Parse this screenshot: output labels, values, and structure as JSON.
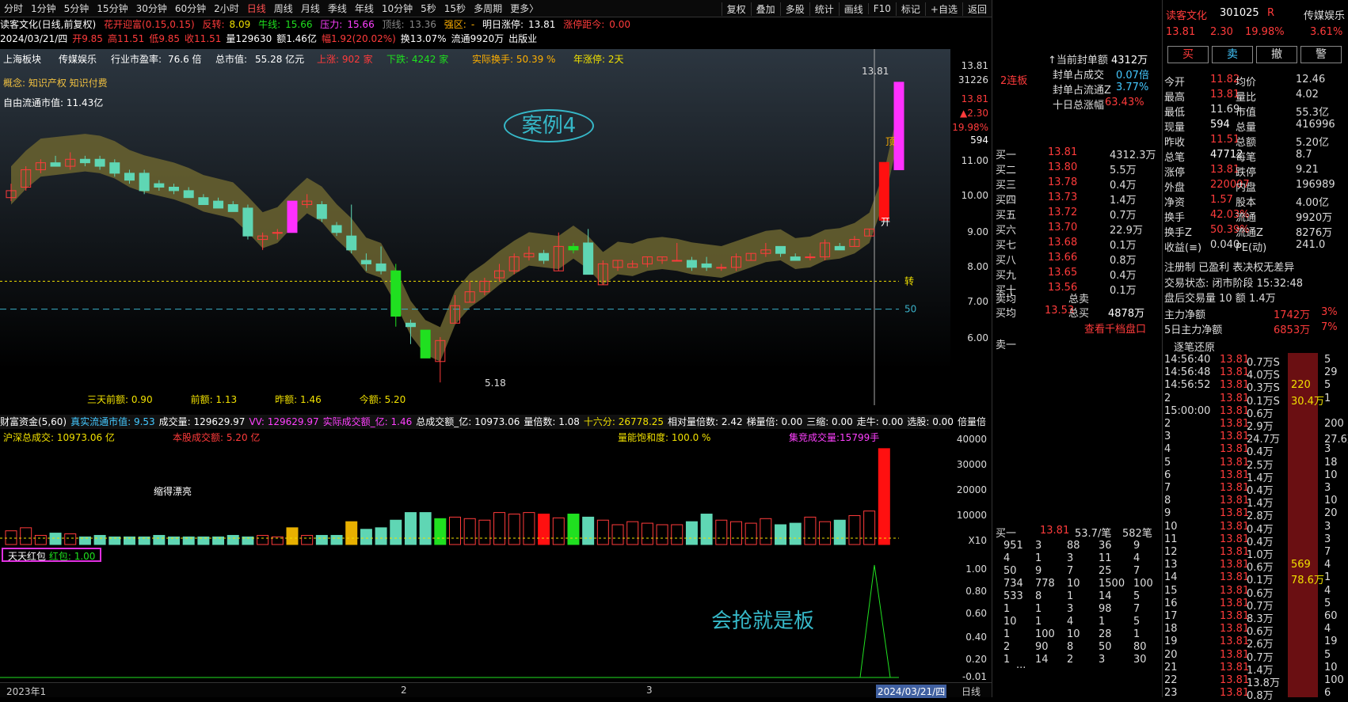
{
  "toolbar": {
    "periods": [
      "分时",
      "1分钟",
      "5分钟",
      "15分钟",
      "30分钟",
      "60分钟",
      "2小时",
      "日线",
      "周线",
      "月线",
      "季线",
      "年线",
      "10分钟",
      "5秒",
      "15秒",
      "多周期",
      "更多〉"
    ],
    "active": "日线",
    "right": [
      "复权",
      "叠加",
      "多股",
      "统计",
      "画线",
      "F10",
      "标记",
      "+自选",
      "返回"
    ]
  },
  "header": {
    "title": "读客文化(日线,前复权)",
    "indicator": "花开迎富(0.15,0.15)",
    "fanzhuan_label": "反转:",
    "fanzhuan": "8.09",
    "niuxian_label": "牛线:",
    "niuxian": "15.66",
    "yali_label": "压力:",
    "yali": "15.66",
    "dingxian_label": "顶线:",
    "dingxian": "13.36",
    "qiangqu_label": "强区:",
    "qiangqu": "-",
    "mingri_label": "明日涨停:",
    "mingri": "13.81",
    "zhangting_label": "涨停距今:",
    "zhangting": "0.00"
  },
  "ohlc": {
    "date": "2024/03/21/四",
    "open": "开9.85",
    "high": "高11.51",
    "low": "低9.85",
    "close": "收11.51",
    "vol": "量129630",
    "amt": "额1.46亿",
    "chg": "幅1.92(20.02%)",
    "turn": "换13.07%",
    "float": "流通9920万",
    "industry": "出版业"
  },
  "topinfo": {
    "board": "上海板块",
    "sector": "传媒娱乐",
    "pe_label": "行业市盈率:",
    "pe": "76.6 倍",
    "mv_label": "总市值:",
    "mv": "55.28 亿元",
    "up": "上涨: 902 家",
    "down": "下跌: 4242 家",
    "turnover": "实际换手: 50.39 %",
    "years": "年涨停: 2天"
  },
  "concept": "概念: 知识产权 知识付费",
  "ltmv": "自由流通市值: 11.43亿",
  "case_label": "案例4",
  "chart_data": {
    "type": "candlestick",
    "ylim": [
      5,
      14.5
    ],
    "candles": [
      [
        10.5,
        10.9,
        10.4,
        10.7
      ],
      [
        10.8,
        11.4,
        10.7,
        11.3
      ],
      [
        11.3,
        11.6,
        11.2,
        11.5
      ],
      [
        11.5,
        11.7,
        11.4,
        11.4
      ],
      [
        11.4,
        11.8,
        11.3,
        11.6
      ],
      [
        11.6,
        11.7,
        11.4,
        11.5
      ],
      [
        11.6,
        11.7,
        11.3,
        11.4
      ],
      [
        11.5,
        11.6,
        11.1,
        11.2
      ],
      [
        11.2,
        11.3,
        10.9,
        11.0
      ],
      [
        11.2,
        11.3,
        10.6,
        10.7
      ],
      [
        10.9,
        11.0,
        10.7,
        10.8
      ],
      [
        10.8,
        10.9,
        10.6,
        10.7
      ],
      [
        10.7,
        10.8,
        10.5,
        10.5
      ],
      [
        10.5,
        10.6,
        10.3,
        10.3
      ],
      [
        10.4,
        10.5,
        10.2,
        10.2
      ],
      [
        10.3,
        10.4,
        10.1,
        10.1
      ],
      [
        10.2,
        10.3,
        9.3,
        9.4
      ],
      [
        9.3,
        9.5,
        9.0,
        9.4
      ],
      [
        9.5,
        9.6,
        9.3,
        9.5
      ],
      [
        10.4,
        10.4,
        9.5,
        9.5
      ],
      [
        10.3,
        10.6,
        10.2,
        10.4
      ],
      [
        10.3,
        10.4,
        9.8,
        9.9
      ],
      [
        9.7,
        9.8,
        9.4,
        9.5
      ],
      [
        9.4,
        10.3,
        8.9,
        9.0
      ],
      [
        8.7,
        8.9,
        8.4,
        8.6
      ],
      [
        8.6,
        9.1,
        8.3,
        8.4
      ],
      [
        8.4,
        8.6,
        6.8,
        7.1
      ],
      [
        6.9,
        7.0,
        6.3,
        6.8
      ],
      [
        6.7,
        6.7,
        5.9,
        5.9
      ],
      [
        5.8,
        6.5,
        5.2,
        6.4
      ],
      [
        6.9,
        7.7,
        6.9,
        7.4
      ],
      [
        7.5,
        8.1,
        7.5,
        7.8
      ],
      [
        7.8,
        8.2,
        7.7,
        8.1
      ],
      [
        8.2,
        8.6,
        8.1,
        8.4
      ],
      [
        8.4,
        8.9,
        8.3,
        8.8
      ],
      [
        8.8,
        9.1,
        8.7,
        8.9
      ],
      [
        8.9,
        9.0,
        8.6,
        8.7
      ],
      [
        8.4,
        9.5,
        8.4,
        9.1
      ],
      [
        9.1,
        9.2,
        8.9,
        9.0
      ],
      [
        9.2,
        9.6,
        8.3,
        8.3
      ],
      [
        8.0,
        8.7,
        8.0,
        8.6
      ],
      [
        8.5,
        8.7,
        8.4,
        8.7
      ],
      [
        8.5,
        8.7,
        8.5,
        8.6
      ],
      [
        8.6,
        8.8,
        8.5,
        8.8
      ],
      [
        8.7,
        8.8,
        8.6,
        8.8
      ],
      [
        8.7,
        9.2,
        8.7,
        8.7
      ],
      [
        8.7,
        8.8,
        8.4,
        8.5
      ],
      [
        8.6,
        8.8,
        8.4,
        8.5
      ],
      [
        8.5,
        8.6,
        8.4,
        8.5
      ],
      [
        8.5,
        8.9,
        8.4,
        8.8
      ],
      [
        8.7,
        8.9,
        8.7,
        8.9
      ],
      [
        8.9,
        9.2,
        8.8,
        9.0
      ],
      [
        9.1,
        9.1,
        8.8,
        8.9
      ],
      [
        8.8,
        8.9,
        8.7,
        8.7
      ],
      [
        8.8,
        8.9,
        8.7,
        8.8
      ],
      [
        8.8,
        9.3,
        8.7,
        9.2
      ],
      [
        9.1,
        9.2,
        9.0,
        9.0
      ],
      [
        9.1,
        9.4,
        9.1,
        9.3
      ],
      [
        9.4,
        9.6,
        9.4,
        9.6
      ],
      [
        9.85,
        11.51,
        9.85,
        11.51
      ],
      [
        11.3,
        13.81,
        11.3,
        13.81
      ]
    ],
    "labels": {
      "max": "13.81",
      "min": "5.18",
      "zhuan": "转",
      "fifty": "50",
      "kai": "开",
      "ding": "顶"
    },
    "bottom": {
      "a": "三天前额: 0.90",
      "b": "前额: 1.13",
      "c": "昨额: 1.46",
      "d": "今额: 5.20"
    }
  },
  "yaxis": [
    "13.81",
    "31226",
    "13.81",
    "▲2.30",
    "19.98%",
    "594",
    "11.00",
    "10.00",
    "9.00",
    "8.00",
    "7.00",
    "6.00"
  ],
  "vol_head": {
    "name": "财富资金(5,60)",
    "real": "真实流通市值: 9.53",
    "vol": "成交量: 129629.97",
    "vv": "VV: 129629.97",
    "amt": "实际成交额_亿: 1.46",
    "total": "总成交额_亿: 10973.06",
    "mult": "量倍数: 1.08",
    "sixteen": "十六分: 26778.25",
    "rel": "相对量倍数: 2.42",
    "ladder": "梯量倍: 0.00",
    "suo": "三缩: 0.00",
    "zou": "走牛: 0.00",
    "xuan": "选股: 0.00",
    "bei": "倍量倍"
  },
  "vol2": {
    "total": "沪深总成交: 10973.06 亿",
    "own": "本股成交额: 5.20 亿",
    "sat": "量能饱和度: 100.0 %",
    "jj": "集竞成交量:15799手",
    "shrink": "缩得漂亮"
  },
  "vol_data": [
    18,
    22,
    12,
    15,
    14,
    10,
    12,
    10,
    10,
    10,
    12,
    10,
    10,
    10,
    10,
    12,
    10,
    12,
    10,
    22,
    12,
    12,
    12,
    30,
    20,
    22,
    32,
    42,
    42,
    34,
    36,
    34,
    32,
    42,
    40,
    42,
    40,
    35,
    40,
    36,
    32,
    26,
    30,
    28,
    26,
    26,
    30,
    40,
    32,
    30,
    28,
    34,
    26,
    28,
    36,
    30,
    32,
    38,
    44,
    126
  ],
  "vol_yaxis": [
    "40000",
    "30000",
    "20000",
    "10000",
    "X10"
  ],
  "ind": {
    "name": "天天红包",
    "label": "红包: 1.00"
  },
  "ind_yaxis": [
    "1.00",
    "0.80",
    "0.60",
    "0.40",
    "0.20",
    "-0.01"
  ],
  "slogan": "会抢就是板",
  "dates": {
    "a": "2023年1",
    "b": "2",
    "c": "3",
    "d": "2024/03/21/四",
    "e": "日线"
  },
  "mid": {
    "lianban": "2连板",
    "seal_amt_label": "↑当前封单额",
    "seal_amt": "4312万",
    "seal_ratio_label": "封单占成交",
    "seal_ratio": "0.07倍",
    "seal_float_label": "封单占流通Z",
    "seal_float": "3.77%",
    "ten_label": "十日总涨幅",
    "ten": "63.43%",
    "buy": [
      [
        "买一",
        "13.81",
        "4312.3万"
      ],
      [
        "买二",
        "13.80",
        "5.5万"
      ],
      [
        "买三",
        "13.78",
        "0.4万"
      ],
      [
        "买四",
        "13.73",
        "1.4万"
      ],
      [
        "买五",
        "13.72",
        "0.7万"
      ],
      [
        "买六",
        "13.70",
        "22.9万"
      ],
      [
        "买七",
        "13.68",
        "0.1万"
      ],
      [
        "买八",
        "13.66",
        "0.8万"
      ],
      [
        "买九",
        "13.65",
        "0.4万"
      ],
      [
        "买十",
        "13.56",
        "0.1万"
      ]
    ],
    "avg_sell_label": "卖均",
    "total_sell_label": "总卖",
    "avg_buy_label": "买均",
    "avg_buy": "13.53",
    "total_buy_label": "总买",
    "total_buy": "4878万",
    "link": "查看千档盘口",
    "sell1": "卖一",
    "b1_label": "买一",
    "b1_price": "13.81",
    "b1_per": "53.7/笔",
    "b1_cnt": "582笔",
    "queue": [
      [
        "951",
        "3",
        "88",
        "36",
        "9"
      ],
      [
        "4",
        "1",
        "3",
        "11",
        "4"
      ],
      [
        "50",
        "9",
        "7",
        "25",
        "7"
      ],
      [
        "734",
        "778",
        "10",
        "1500",
        "100"
      ],
      [
        "533",
        "8",
        "1",
        "14",
        "5"
      ],
      [
        "1",
        "1",
        "3",
        "98",
        "7"
      ],
      [
        "10",
        "1",
        "4",
        "1",
        "5"
      ],
      [
        "1",
        "100",
        "10",
        "28",
        "1"
      ],
      [
        "2",
        "90",
        "8",
        "50",
        "80"
      ],
      [
        "1",
        "14",
        "2",
        "3",
        "30"
      ]
    ],
    "dots": "..."
  },
  "right": {
    "name": "读客文化",
    "code": "301025",
    "r": "R",
    "price": "13.81",
    "chg": "2.30",
    "pct": "19.98%",
    "sector": "传媒娱乐",
    "sector_pct": "3.61%",
    "buy": "买",
    "sell": "卖",
    "cancel": "撤",
    "alert": "警",
    "stats": [
      [
        "今开",
        "11.82",
        "均价",
        "12.46"
      ],
      [
        "最高",
        "13.81",
        "量比",
        "4.02"
      ],
      [
        "最低",
        "11.69",
        "市值",
        "55.3亿"
      ],
      [
        "现量",
        "594",
        "总量",
        "416996"
      ],
      [
        "昨收",
        "11.51",
        "总额",
        "5.20亿"
      ],
      [
        "总笔",
        "47712",
        "每笔",
        "8.7"
      ],
      [
        "涨停",
        "13.81",
        "跌停",
        "9.21"
      ],
      [
        "外盘",
        "220007",
        "内盘",
        "196989"
      ],
      [
        "净资",
        "1.57",
        "股本",
        "4.00亿"
      ],
      [
        "换手",
        "42.03%",
        "流通",
        "9920万"
      ],
      [
        "换手Z",
        "50.39%",
        "流通Z",
        "8276万"
      ],
      [
        "收益(≡)",
        "0.040",
        "PE(动)",
        "241.0"
      ]
    ],
    "reg": "注册制 已盈利 表决权无差异",
    "state": "交易状态: 闭市阶段 15:32:48",
    "after": "盘后交易量 10 额 1.4万",
    "main_net_label": "主力净额",
    "main_net": "1742万",
    "main_net_pct": "3%",
    "five_label": "5日主力净额",
    "five": "6853万",
    "five_pct": "7%",
    "ticks_title": "逐笔还原",
    "ticks": [
      [
        "14:56:40",
        "13.81",
        "0.7万S",
        "",
        "5"
      ],
      [
        "14:56:48",
        "13.81",
        "4.0万S",
        "",
        "29"
      ],
      [
        "14:56:52",
        "13.81",
        "0.3万S",
        "220",
        "5"
      ],
      [
        "2",
        "13.81",
        "0.1万S",
        "30.4万",
        "1"
      ],
      [
        "15:00:00",
        "13.81",
        "0.6万",
        "",
        ""
      ],
      [
        "2",
        "13.81",
        "2.9万",
        "",
        "200"
      ],
      [
        "3",
        "13.81",
        "24.7万",
        "",
        "27.6万"
      ],
      [
        "4",
        "13.81",
        "0.4万",
        "",
        "3"
      ],
      [
        "5",
        "13.81",
        "2.5万",
        "",
        "18"
      ],
      [
        "6",
        "13.81",
        "1.4万",
        "",
        "10"
      ],
      [
        "7",
        "13.81",
        "0.4万",
        "",
        "3"
      ],
      [
        "8",
        "13.81",
        "1.4万",
        "",
        "10"
      ],
      [
        "9",
        "13.81",
        "2.8万",
        "",
        "20"
      ],
      [
        "10",
        "13.81",
        "0.4万",
        "",
        "3"
      ],
      [
        "11",
        "13.81",
        "0.4万",
        "",
        "3"
      ],
      [
        "12",
        "13.81",
        "1.0万",
        "",
        "7"
      ],
      [
        "13",
        "13.81",
        "0.6万",
        "569",
        "4"
      ],
      [
        "14",
        "13.81",
        "0.1万",
        "78.6万",
        "1"
      ],
      [
        "15",
        "13.81",
        "0.6万",
        "",
        "4"
      ],
      [
        "16",
        "13.81",
        "0.7万",
        "",
        "5"
      ],
      [
        "17",
        "13.81",
        "8.3万",
        "",
        "60"
      ],
      [
        "18",
        "13.81",
        "0.6万",
        "",
        "4"
      ],
      [
        "19",
        "13.81",
        "2.6万",
        "",
        "19"
      ],
      [
        "20",
        "13.81",
        "0.7万",
        "",
        "5"
      ],
      [
        "21",
        "13.81",
        "1.4万",
        "",
        "10"
      ],
      [
        "22",
        "13.81",
        "13.8万",
        "",
        "100"
      ],
      [
        "23",
        "13.81",
        "0.8万",
        "",
        "6"
      ]
    ]
  }
}
